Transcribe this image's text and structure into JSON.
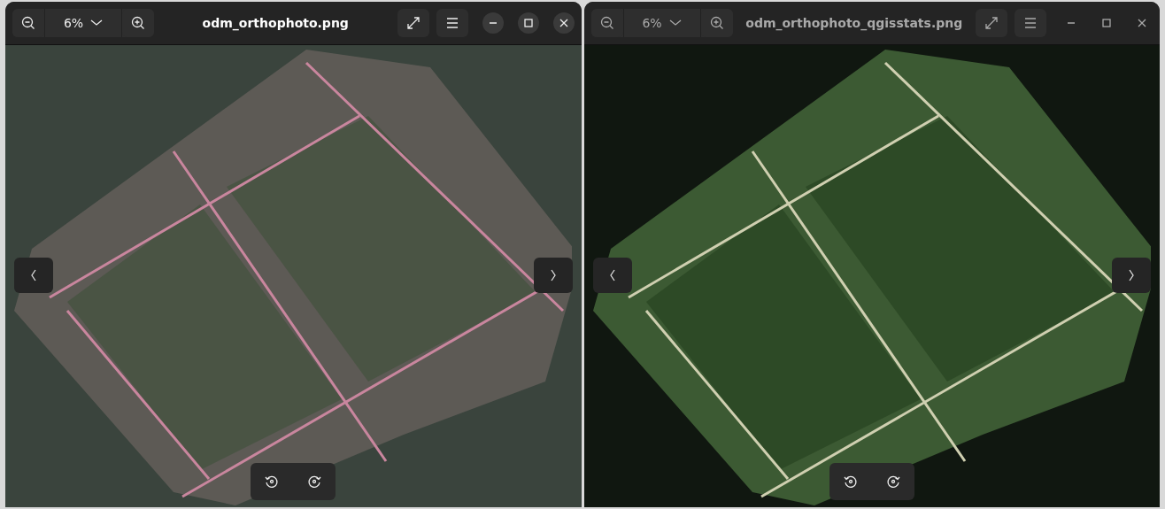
{
  "windows": [
    {
      "title": "odm_orthophoto.png",
      "zoom": "6%",
      "active": true
    },
    {
      "title": "odm_orthophoto_qgisstats.png",
      "zoom": "6%",
      "active": false
    }
  ]
}
